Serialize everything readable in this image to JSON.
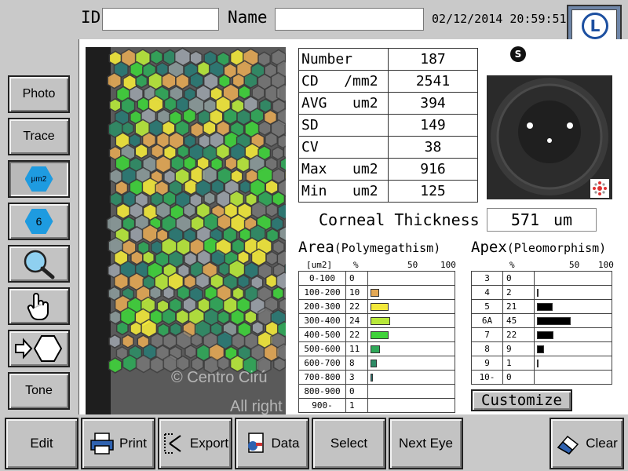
{
  "header": {
    "id_label": "ID",
    "id_value": "",
    "name_label": "Name",
    "name_value": "",
    "datetime": "02/12/2014 20:59:51",
    "eye_letter": "L",
    "eye_side": "OS"
  },
  "tools": [
    {
      "label": "Photo"
    },
    {
      "label": "Trace"
    },
    {
      "label": "μm2",
      "icon": "area-unit-icon"
    },
    {
      "label": "6",
      "icon": "hexagon-count-icon"
    },
    {
      "label": "",
      "icon": "magnifier-icon"
    },
    {
      "label": "",
      "icon": "hand-pointer-icon"
    },
    {
      "label": "",
      "icon": "arrow-hexagon-icon"
    },
    {
      "label": "Tone"
    }
  ],
  "watermark": {
    "line1": "© Centro Cirú",
    "line2": "All right"
  },
  "stats": [
    {
      "key": "Number",
      "value": "187"
    },
    {
      "key": "CD   /mm2",
      "value": "2541"
    },
    {
      "key": "AVG   um2",
      "value": "394"
    },
    {
      "key": "SD",
      "value": "149"
    },
    {
      "key": "CV",
      "value": "38"
    },
    {
      "key": "Max   um2",
      "value": "916"
    },
    {
      "key": "Min   um2",
      "value": "125"
    }
  ],
  "s_icon": "S",
  "corneal": {
    "label": "Corneal Thickness",
    "value": "571",
    "unit": "um"
  },
  "area": {
    "title": "Area",
    "subtitle": "(Polymegathism)",
    "unit": "[um2]",
    "pct": "%",
    "s50": "50",
    "s100": "100",
    "rows": [
      {
        "range": "0-100",
        "pct": "0",
        "value": 0,
        "color": ""
      },
      {
        "range": "100-200",
        "pct": "10",
        "value": 10,
        "color": "#e3a855"
      },
      {
        "range": "200-300",
        "pct": "22",
        "value": 22,
        "color": "#f2e83a"
      },
      {
        "range": "300-400",
        "pct": "24",
        "value": 24,
        "color": "#b8e83a"
      },
      {
        "range": "400-500",
        "pct": "22",
        "value": 22,
        "color": "#3fd23a"
      },
      {
        "range": "500-600",
        "pct": "11",
        "value": 11,
        "color": "#2fa858"
      },
      {
        "range": "600-700",
        "pct": "8",
        "value": 8,
        "color": "#2e8c66"
      },
      {
        "range": "700-800",
        "pct": "3",
        "value": 3,
        "color": "#2a7a74"
      },
      {
        "range": "800-900",
        "pct": "0",
        "value": 0,
        "color": ""
      },
      {
        "range": "900-",
        "pct": "1",
        "value": 1,
        "color": ""
      }
    ]
  },
  "apex": {
    "title": "Apex",
    "subtitle": "(Pleomorphism)",
    "pct": "%",
    "s50": "50",
    "s100": "100",
    "rows": [
      {
        "n": "3",
        "pct": "0",
        "value": 0
      },
      {
        "n": "4",
        "pct": "2",
        "value": 2
      },
      {
        "n": "5",
        "pct": "21",
        "value": 21
      },
      {
        "n": "6A",
        "pct": "45",
        "value": 45
      },
      {
        "n": "7",
        "pct": "22",
        "value": 22
      },
      {
        "n": "8",
        "pct": "9",
        "value": 9
      },
      {
        "n": "9",
        "pct": "1",
        "value": 1
      },
      {
        "n": "10-",
        "pct": "0",
        "value": 0
      }
    ]
  },
  "customize_label": "Customize",
  "bottom": {
    "edit": "Edit",
    "print": "Print",
    "export": "Export",
    "data": "Data",
    "select": "Select",
    "next_eye": "Next Eye",
    "clear": "Clear"
  }
}
